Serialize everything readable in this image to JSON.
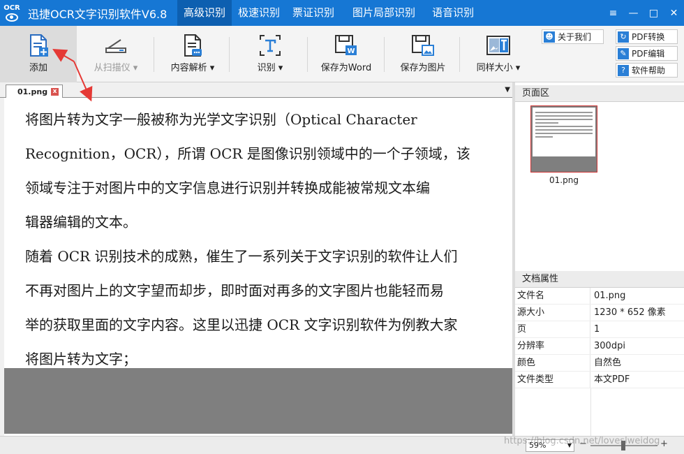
{
  "app": {
    "logo_text": "OCR",
    "title": "迅捷OCR文字识别软件V6.8",
    "nav_tabs": [
      "高级识别",
      "极速识别",
      "票证识别",
      "图片局部识别",
      "语音识别"
    ],
    "active_tab": "高级识别"
  },
  "window_controls": {
    "menu": "≡",
    "minimize": "—",
    "maximize": "□",
    "close": "✕"
  },
  "toolbar": {
    "add": "添加",
    "scan": "从扫描仪",
    "content_parse": "内容解析",
    "recognize": "识别",
    "save_word": "保存为Word",
    "save_image": "保存为图片",
    "same_size": "同样大小",
    "about": "关于我们",
    "pdf_convert": "PDF转换",
    "pdf_edit": "PDF编辑",
    "help": "软件帮助"
  },
  "document_tab": {
    "name": "01.png",
    "close": "x"
  },
  "editor": {
    "lines": [
      "将图片转为文字一般被称为光学文字识别（Optical  Character",
      "Recognition，OCR），所谓 OCR 是图像识别领域中的一个子领域，该",
      "领域专注于对图片中的文字信息进行识别并转换成能被常规文本编",
      "辑器编辑的文本。",
      "随着 OCR 识别技术的成熟，催生了一系列关于文字识别的软件让人们",
      "不再对图片上的文字望而却步，即时面对再多的文字图片也能轻而易",
      "举的获取里面的文字内容。这里以迅捷 OCR 文字识别软件为例教大家",
      "将图片转为文字；"
    ]
  },
  "pages_panel": {
    "title": "页面区",
    "thumbnail_label": "01.png"
  },
  "properties_panel": {
    "title": "文档属性",
    "rows": [
      {
        "key": "文件名",
        "value": "01.png"
      },
      {
        "key": "源大小",
        "value": "1230 * 652 像素"
      },
      {
        "key": "页",
        "value": "1"
      },
      {
        "key": "分辨率",
        "value": "300dpi"
      },
      {
        "key": "颜色",
        "value": "自然色"
      },
      {
        "key": "文件类型",
        "value": "本文PDF"
      }
    ]
  },
  "statusbar": {
    "zoom": "59%",
    "minus": "−",
    "plus": "+"
  },
  "watermark": "https://blog.csdn.net/loveslweidog",
  "colors": {
    "title_bar": "#1677d4",
    "active_tab": "#0d5fb0",
    "annotation_arrow": "#e53935",
    "accent_icon": "#2a7fd6"
  }
}
